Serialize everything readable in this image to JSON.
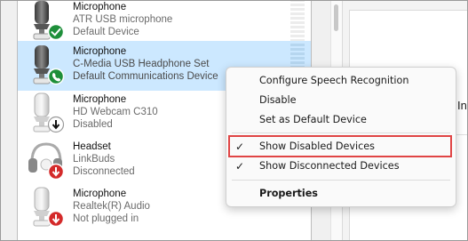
{
  "devices": [
    {
      "name": "Microphone",
      "detail1": "ATR USB microphone",
      "detail2": "Default Device",
      "type": "microphone",
      "status": "default",
      "selected": false
    },
    {
      "name": "Microphone",
      "detail1": "C-Media USB Headphone Set",
      "detail2": "Default Communications Device",
      "type": "microphone",
      "status": "communications",
      "selected": true
    },
    {
      "name": "Microphone",
      "detail1": "HD Webcam C310",
      "detail2": "Disabled",
      "type": "microphone",
      "status": "disabled",
      "selected": false
    },
    {
      "name": "Headset",
      "detail1": "LinkBuds",
      "detail2": "Disconnected",
      "type": "headset",
      "status": "disconnected",
      "selected": false
    },
    {
      "name": "Microphone",
      "detail1": "Realtek(R) Audio",
      "detail2": "Not plugged in",
      "type": "microphone",
      "status": "unplugged",
      "selected": false
    }
  ],
  "context_menu": {
    "items": [
      {
        "label": "Configure Speech Recognition",
        "checked": false,
        "bold": false
      },
      {
        "label": "Disable",
        "checked": false,
        "bold": false
      },
      {
        "label": "Set as Default Device",
        "checked": false,
        "bold": false
      },
      {
        "label": "Show Disabled Devices",
        "checked": true,
        "bold": false,
        "highlighted": true
      },
      {
        "label": "Show Disconnected Devices",
        "checked": true,
        "bold": false
      },
      {
        "label": "Properties",
        "checked": false,
        "bold": true
      }
    ],
    "check_glyph": "✓"
  },
  "right_panel": {
    "text": "In"
  },
  "colors": {
    "selected_row": "#cce8ff",
    "status_green": "#1e8f3a",
    "status_red": "#d42a2a",
    "highlight_border": "#e04545"
  }
}
